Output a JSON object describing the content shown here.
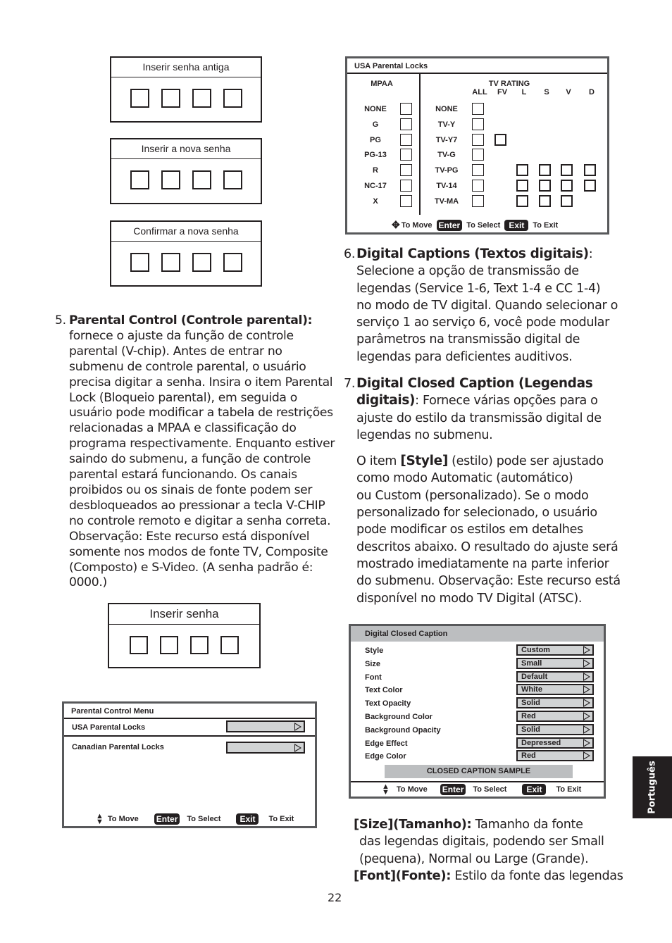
{
  "password_dialogs": {
    "old": {
      "label": "Inserir senha antiga",
      "digits": 4
    },
    "new": {
      "label": "Inserir a nova senha",
      "digits": 4
    },
    "confirm": {
      "label": "Confirmar a nova senha",
      "digits": 4
    },
    "enter": {
      "label": "Inserir senha",
      "digits": 4
    }
  },
  "section5": {
    "number": "5.",
    "heading": "Parental Control (Controle parental):",
    "lines": [
      "fornece o ajuste da função de controle",
      "parental (V-chip). Antes de entrar no",
      "submenu de controle parental, o usuário",
      "precisa digitar a senha. Insira o item Parental",
      "Lock (Bloqueio parental), em seguida o",
      "usuário pode modificar a tabela de restrições",
      "relacionadas a MPAA e classificação do",
      "programa respectivamente. Enquanto estiver",
      "saindo do submenu, a função de controle",
      "parental estará funcionando. Os canais",
      "proibidos ou os sinais de fonte podem ser",
      "desbloqueados ao pressionar a tecla V-CHIP",
      "no controle remoto e digitar a senha correta.",
      "Observação: Este recurso está disponível",
      "somente nos modos de fonte TV, Composite",
      "(Composto) e S-Video. (A senha padrão é:",
      "0000.)"
    ]
  },
  "parental_menu": {
    "title": "Parental Control Menu",
    "items": [
      {
        "label": "USA Parental Locks"
      },
      {
        "label": "Canadian Parental Locks"
      }
    ],
    "hints": {
      "move": "To Move",
      "enter_key": "Enter",
      "select": "To Select",
      "exit_key": "Exit",
      "exit": "To Exit"
    }
  },
  "usa_locks": {
    "title": "USA Parental Locks",
    "mpaa_header": "MPAA",
    "tv_header": "TV RATING",
    "tv_columns": [
      "ALL",
      "FV",
      "L",
      "S",
      "V",
      "D"
    ],
    "mpaa_ratings": [
      "NONE",
      "G",
      "PG",
      "PG-13",
      "R",
      "NC-17",
      "X"
    ],
    "tv_ratings": [
      {
        "label": "NONE",
        "boxes": [
          true,
          false,
          false,
          false,
          false,
          false
        ]
      },
      {
        "label": "TV-Y",
        "boxes": [
          true,
          false,
          false,
          false,
          false,
          false
        ]
      },
      {
        "label": "TV-Y7",
        "boxes": [
          true,
          true,
          false,
          false,
          false,
          false
        ]
      },
      {
        "label": "TV-G",
        "boxes": [
          true,
          false,
          false,
          false,
          false,
          false
        ]
      },
      {
        "label": "TV-PG",
        "boxes": [
          true,
          false,
          true,
          true,
          true,
          true
        ]
      },
      {
        "label": "TV-14",
        "boxes": [
          true,
          false,
          true,
          true,
          true,
          true
        ]
      },
      {
        "label": "TV-MA",
        "boxes": [
          true,
          false,
          true,
          true,
          true,
          false
        ]
      }
    ],
    "hints": {
      "move": "To Move",
      "enter_key": "Enter",
      "select": "To Select",
      "exit_key": "Exit",
      "exit": "To Exit"
    }
  },
  "section6": {
    "number": "6.",
    "heading": "Digital Captions (Textos digitais)",
    "heading_suffix": ":",
    "lines": [
      "Selecione a opção de transmissão de",
      "legendas (Service 1-6, Text 1-4 e CC 1-4)",
      "no modo de TV digital. Quando selecionar o",
      "serviço 1 ao serviço 6, você pode modular",
      "parâmetros na transmissão digital de",
      "legendas para deficientes auditivos."
    ]
  },
  "section7": {
    "number": "7.",
    "heading_line1": "Digital Closed Caption (Legendas",
    "heading_line2": "digitais)",
    "line2_rest": ": Fornece várias opções para o",
    "lines": [
      "ajuste do estilo da transmissão digital de",
      "legendas no submenu."
    ],
    "style_prefix": "O item ",
    "style_bold": "[Style]",
    "style_rest": " (estilo) pode ser ajustado",
    "style_lines": [
      "como modo Automatic (automático)",
      "ou Custom (personalizado). Se o modo",
      "personalizado for selecionado, o usuário",
      "pode modificar os estilos em detalhes",
      "descritos abaixo. O resultado do ajuste será",
      "mostrado imediatamente na parte inferior",
      "do submenu. Observação: Este recurso está",
      "disponível no modo TV Digital (ATSC)."
    ]
  },
  "dcc_menu": {
    "title": "Digital Closed Caption",
    "rows": [
      {
        "label": "Style",
        "value": "Custom"
      },
      {
        "label": "Size",
        "value": "Small"
      },
      {
        "label": "Font",
        "value": "Default"
      },
      {
        "label": "Text Color",
        "value": "White"
      },
      {
        "label": "Text Opacity",
        "value": "Solid"
      },
      {
        "label": "Background Color",
        "value": "Red"
      },
      {
        "label": "Background Opacity",
        "value": "Solid"
      },
      {
        "label": "Edge Effect",
        "value": "Depressed"
      },
      {
        "label": "Edge Color",
        "value": "Red"
      }
    ],
    "sample": "CLOSED CAPTION SAMPLE",
    "hints": {
      "move": "To Move",
      "enter_key": "Enter",
      "select": "To Select",
      "exit_key": "Exit",
      "exit": "To Exit"
    }
  },
  "size_desc": {
    "bold": "[Size](Tamanho):",
    "text1": " Tamanho da fonte",
    "line2": "das legendas digitais, podendo ser Small",
    "line3": "(pequena), Normal ou Large (Grande)."
  },
  "font_desc": {
    "bold": "[Font](Fonte):",
    "text1": " Estilo da fonte das legendas"
  },
  "language_tab": "Português",
  "page_number": "22",
  "colors": {
    "ink": "#231f20",
    "panel_border": "#58595b",
    "field_gray": "#d1d3d4",
    "header_gray": "#bcbec0"
  }
}
